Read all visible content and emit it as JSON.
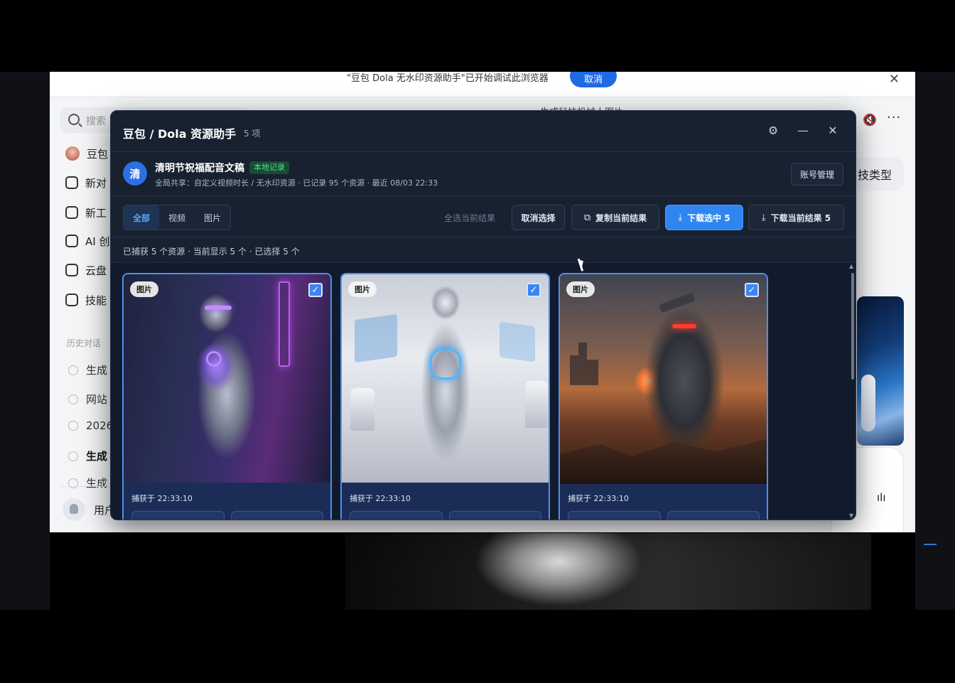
{
  "browser": {
    "debug_banner_text": "\"豆包 Dola 无水印资源助手\"已开始调试此浏览器",
    "debug_cancel_label": "取消",
    "debug_close_icon": "close-icon",
    "search_placeholder": "搜索",
    "nav_items": [
      {
        "label": "豆包",
        "icon": "avatar-icon"
      },
      {
        "label": "新对",
        "icon": "edit-icon"
      },
      {
        "label": "新工",
        "icon": "tool-icon"
      },
      {
        "label": "AI 创",
        "icon": "ai-create-icon"
      },
      {
        "label": "云盘",
        "icon": "cloud-folder-icon"
      },
      {
        "label": "技能",
        "icon": "skill-icon"
      }
    ],
    "history_label": "历史对话",
    "history_items": [
      "生成",
      "网站",
      "2026",
      "生成",
      "生成"
    ],
    "user_label": "用户",
    "top_title": "生成科技机械人图片",
    "chip_label": "技类型",
    "mute_icon": "mute-icon",
    "more_icon": "more-icon",
    "voice_icon": "voice-icon"
  },
  "panel": {
    "title": "豆包 / Dola 资源助手",
    "count": "5 项",
    "settings_icon": "gear-icon",
    "minimize_icon": "minimize-icon",
    "close_icon": "close-icon",
    "account": {
      "avatar_text": "清",
      "name": "清明节祝福配音文稿",
      "badge": "本地记录",
      "desc": "全局共享：自定义视频时长 / 无水印资源 · 已记录 95 个资源 · 最近 08/03 22:33",
      "manage_label": "账号管理"
    },
    "filters": [
      {
        "label": "全部",
        "active": true
      },
      {
        "label": "视频",
        "active": false
      },
      {
        "label": "图片",
        "active": false
      }
    ],
    "select_all_label": "全选当前结果",
    "cancel_select_label": "取消选择",
    "copy_label": "复制当前结果",
    "download_selected_label": "下载选中 5",
    "download_current_label": "下载当前结果 5",
    "status": "已捕获 5 个资源 · 当前显示 5 个 · 已选择 5 个",
    "cards": [
      {
        "tag": "图片",
        "checked": true,
        "time": "捕获于 22:33:10"
      },
      {
        "tag": "图片",
        "checked": true,
        "time": "捕获于 22:33:10"
      },
      {
        "tag": "图片",
        "checked": true,
        "time": "捕获于 22:33:10"
      }
    ]
  },
  "colors": {
    "panel_bg": "#17212f",
    "accent": "#2f86f0",
    "badge_green": "#4be08a",
    "card_border": "#4f8ff0"
  }
}
